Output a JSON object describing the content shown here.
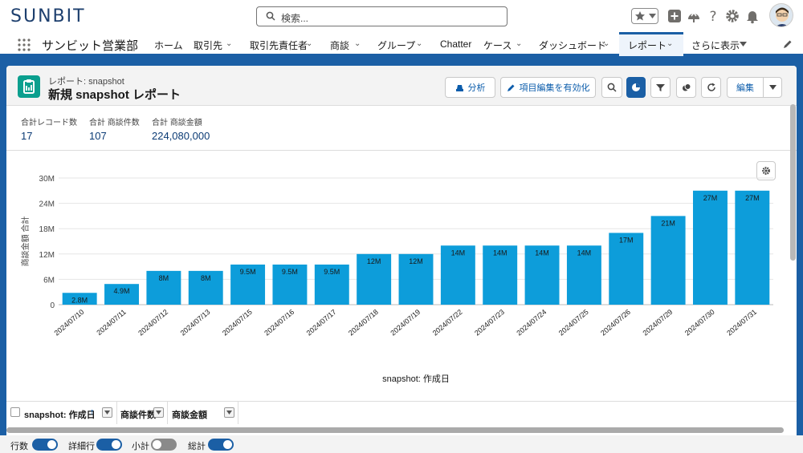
{
  "header": {
    "logo": "SUNBIT",
    "search_placeholder": "検索..."
  },
  "nav": {
    "app_name": "サンビット営業部",
    "items": [
      {
        "label": "ホーム"
      },
      {
        "label": "取引先"
      },
      {
        "label": "取引先責任者"
      },
      {
        "label": "商談"
      },
      {
        "label": "グループ"
      },
      {
        "label": "Chatter"
      },
      {
        "label": "ケース"
      },
      {
        "label": "ダッシュボード"
      },
      {
        "label": "レポート"
      },
      {
        "label": "さらに表示"
      }
    ]
  },
  "report": {
    "subtitle": "レポート: snapshot",
    "title": "新規 snapshot レポート",
    "buttons": {
      "analyze": "分析",
      "enable_field_edit": "項目編集を有効化",
      "edit": "編集"
    }
  },
  "summary": [
    {
      "label": "合計レコード数",
      "value": "17"
    },
    {
      "label": "合計 商談件数",
      "value": "107"
    },
    {
      "label": "合計 商談金額",
      "value": "224,080,000"
    }
  ],
  "chart_data": {
    "type": "bar",
    "title": "",
    "xlabel": "snapshot: 作成日",
    "ylabel": "商談金額 合計",
    "ylim": [
      0,
      30000000
    ],
    "yticks": [
      "0",
      "6M",
      "12M",
      "18M",
      "24M",
      "30M"
    ],
    "color": "#0d9dda",
    "categories": [
      "2024/07/10",
      "2024/07/11",
      "2024/07/12",
      "2024/07/13",
      "2024/07/15",
      "2024/07/16",
      "2024/07/17",
      "2024/07/18",
      "2024/07/19",
      "2024/07/22",
      "2024/07/23",
      "2024/07/24",
      "2024/07/25",
      "2024/07/26",
      "2024/07/29",
      "2024/07/30",
      "2024/07/31"
    ],
    "values": [
      2800000,
      4900000,
      8000000,
      8000000,
      9500000,
      9500000,
      9500000,
      12000000,
      12000000,
      14000000,
      14000000,
      14000000,
      14000000,
      17000000,
      21000000,
      27000000,
      27000000
    ],
    "labels": [
      "2.8M",
      "4.9M",
      "8M",
      "8M",
      "9.5M",
      "9.5M",
      "9.5M",
      "12M",
      "12M",
      "14M",
      "14M",
      "14M",
      "14M",
      "17M",
      "21M",
      "27M",
      "27M"
    ],
    "grid": true
  },
  "table": {
    "columns": [
      "snapshot: 作成日",
      "商談件数",
      "商談金額"
    ]
  },
  "footer": {
    "toggles": [
      {
        "label": "行数",
        "on": true
      },
      {
        "label": "詳細行",
        "on": true
      },
      {
        "label": "小計",
        "on": false
      },
      {
        "label": "総計",
        "on": true
      }
    ]
  }
}
